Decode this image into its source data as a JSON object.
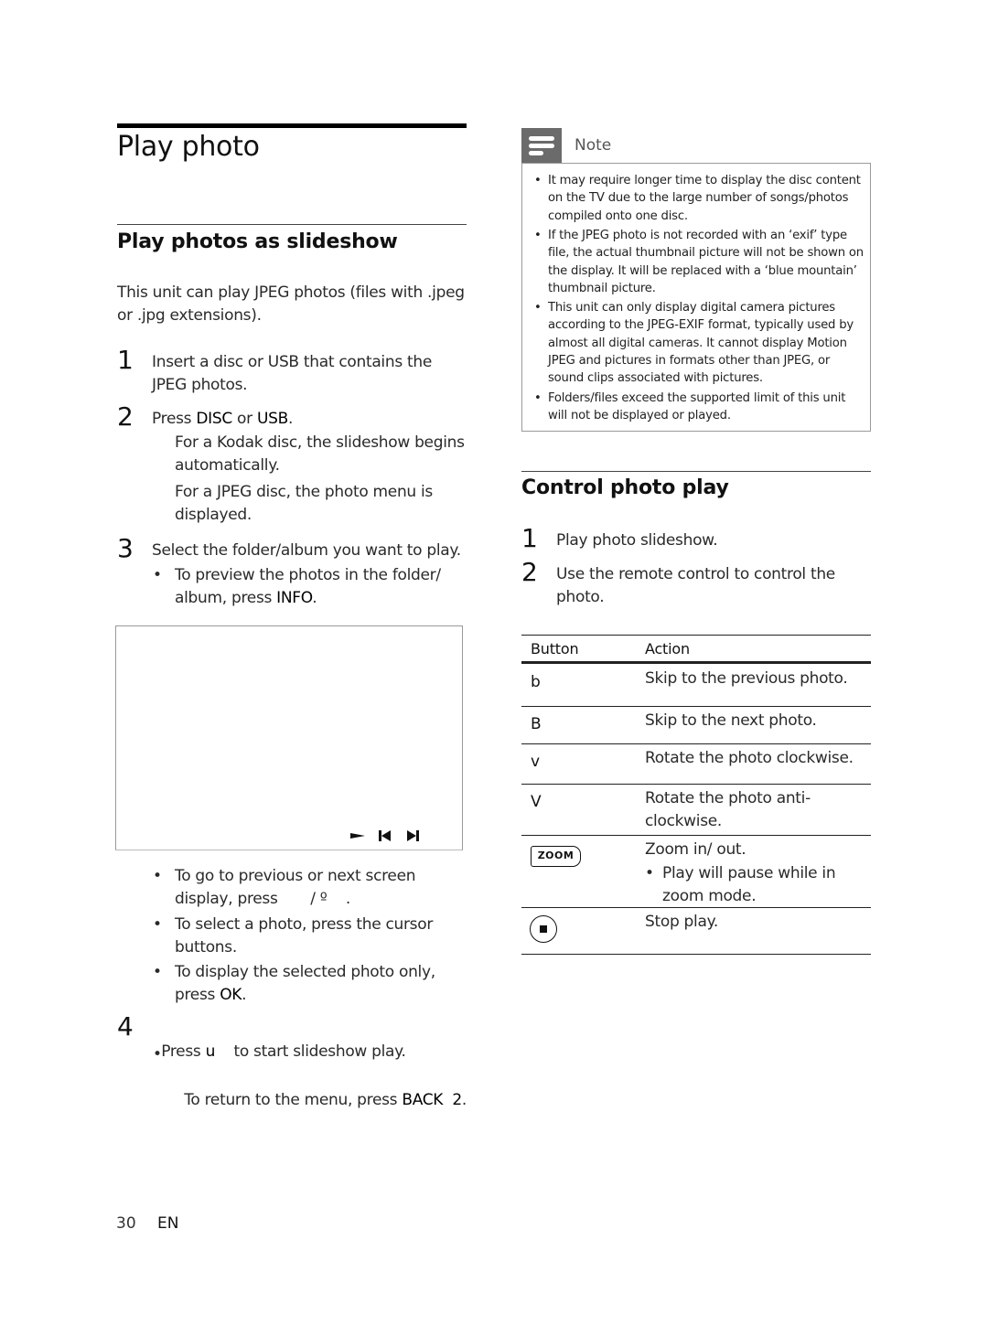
{
  "page": {
    "title": "Play photo",
    "footer": {
      "page_number": "30",
      "language": "EN"
    }
  },
  "slideshow": {
    "heading": "Play photos as slideshow",
    "intro": "This unit can play JPEG photos (files with .jpeg or .jpg extensions).",
    "steps": [
      {
        "number": "1",
        "text": "Insert a disc or USB that contains the JPEG photos."
      },
      {
        "number": "2",
        "text_pre": "Press ",
        "kw1": "DISC",
        "text_mid": " or ",
        "kw2": "USB",
        "text_post": ".",
        "sub": [
          "For a Kodak disc, the slideshow begins automatically.",
          "For a JPEG disc, the photo menu is displayed."
        ]
      },
      {
        "number": "3",
        "text": "Select the folder/album you want to play.",
        "bullets": [
          {
            "pre": "To preview the photos in the folder/ album, press ",
            "kw": "INFO",
            "post": "."
          }
        ]
      },
      {
        "number": "4",
        "text_pre": "Press ",
        "kw": "u",
        "text_post": "    to start slideshow play.",
        "bullets": [
          {
            "pre": "To return to the menu, press ",
            "kw": "BACK  2",
            "post": "."
          }
        ]
      }
    ],
    "preview_controls": [
      "play-icon",
      "previous-icon",
      "next-icon"
    ],
    "after_preview_bullets": [
      {
        "pre": "To go to previous or next screen display, press       / º    .",
        "kw": "",
        "post": ""
      },
      {
        "pre": "To select a photo, press the cursor buttons.",
        "kw": "",
        "post": ""
      },
      {
        "pre": "To display the selected photo only, press ",
        "kw": "OK",
        "post": "."
      }
    ]
  },
  "note": {
    "label": "Note",
    "icon": "note-icon",
    "items": [
      "It may require longer time to display the disc content on the TV due to the large number of songs/photos compiled onto one disc.",
      "If the JPEG photo is not recorded with an ‘exif’ type file, the actual thumbnail picture will not be shown on the display.  It will be replaced with a ‘blue mountain’ thumbnail picture.",
      "This unit can only display digital camera pictures according to the JPEG-EXIF format, typically used by almost all digital cameras.  It cannot display Motion JPEG and pictures in formats other than JPEG, or sound clips associated with pictures.",
      "Folders/files exceed the supported limit of this unit will not be displayed or played."
    ]
  },
  "control": {
    "heading": "Control photo play",
    "steps": [
      {
        "number": "1",
        "text": "Play photo slideshow."
      },
      {
        "number": "2",
        "text": "Use the remote control to control the photo."
      }
    ],
    "table": {
      "headers": [
        "Button",
        "Action"
      ],
      "rows": [
        {
          "button": "b",
          "action": "Skip to the previous photo."
        },
        {
          "button": "B",
          "action": "Skip to the next photo."
        },
        {
          "button": "v",
          "action": "Rotate the photo clockwise."
        },
        {
          "button": "V",
          "action": "Rotate the photo anti-clockwise."
        },
        {
          "button": "ZOOM",
          "action": "Zoom in/ out.",
          "bullet": "Play will pause while in zoom mode."
        },
        {
          "button": "stop-icon",
          "action": "Stop play."
        }
      ]
    }
  },
  "colors": {
    "note_header": "#6b6b6b",
    "rule": "#000000",
    "text": "#2a2a2a"
  }
}
